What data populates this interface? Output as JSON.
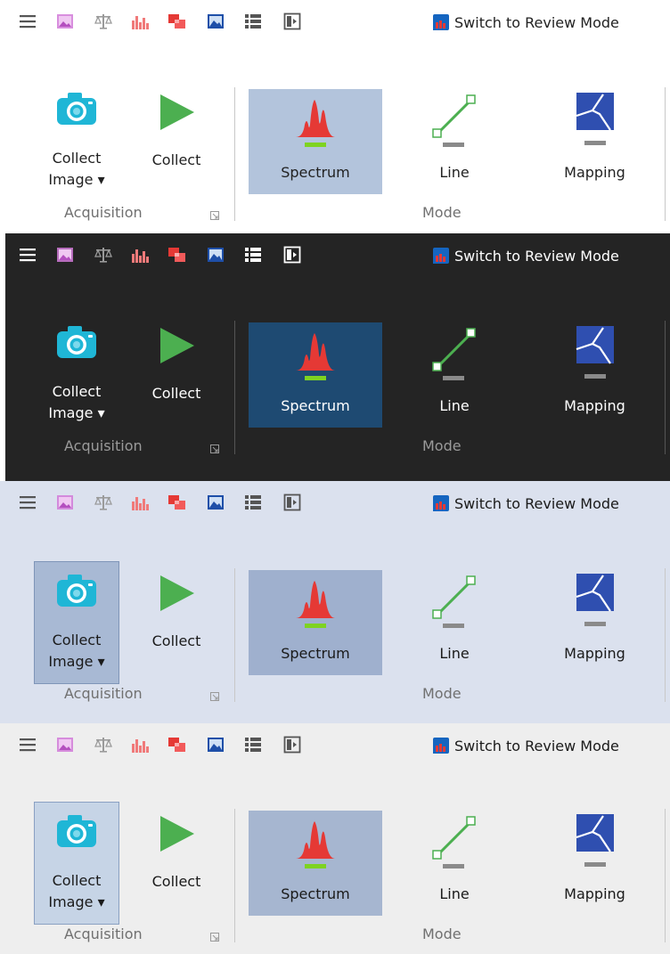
{
  "toolbar": {
    "icons": [
      "menu-icon",
      "image-icon",
      "balance-icon",
      "histogram-icon",
      "layers-icon",
      "picture-icon",
      "list-icon",
      "panel-icon"
    ],
    "switch_label": "Switch to Review Mode"
  },
  "ribbon": {
    "collect_image_line1": "Collect",
    "collect_image_line2": "Image ▾",
    "collect_label": "Collect",
    "spectrum_label": "Spectrum",
    "line_label": "Line",
    "mapping_label": "Mapping",
    "acquisition_group": "Acquisition",
    "mode_group": "Mode"
  },
  "themes": [
    {
      "name": "light",
      "background": "#ffffff"
    },
    {
      "name": "dark",
      "background": "#242424"
    },
    {
      "name": "blue",
      "background": "#dbe1ee"
    },
    {
      "name": "gray",
      "background": "#eeeeee"
    }
  ],
  "colors": {
    "camera": "#1fb6d6",
    "play": "#4caf50",
    "spectrum": "#e53935",
    "spectrum_bar": "#7ed321",
    "line": "#4caf50",
    "mapping": "#2f4fb0",
    "switch_icon_blue": "#1565c0",
    "switch_icon_red": "#e53935"
  }
}
